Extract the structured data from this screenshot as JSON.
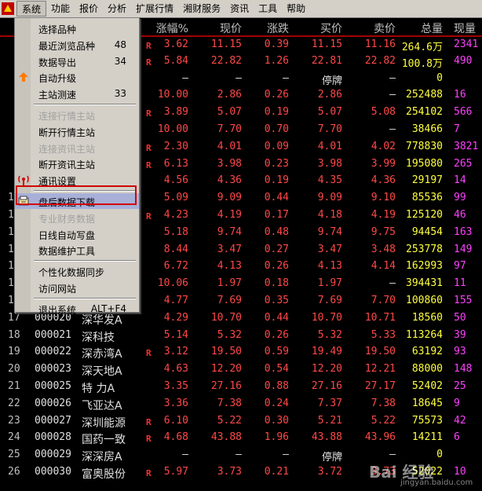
{
  "menubar": {
    "items": [
      "系统",
      "功能",
      "报价",
      "分析",
      "扩展行情",
      "湘财服务",
      "资讯",
      "工具",
      "帮助"
    ]
  },
  "table": {
    "headers": [
      "涨幅%",
      "现价",
      "涨跌",
      "买价",
      "卖价",
      "总量",
      "现量"
    ],
    "rows": [
      {
        "idx": "",
        "code": "",
        "name": "",
        "mark": "R",
        "chg": "3.62",
        "price": "11.15",
        "diff": "0.39",
        "bid": "11.15",
        "ask": "11.16",
        "vol": "264.6万",
        "cur": "2341"
      },
      {
        "idx": "",
        "code": "",
        "name": "",
        "mark": "R",
        "chg": "5.84",
        "price": "22.82",
        "diff": "1.26",
        "bid": "22.81",
        "ask": "22.82",
        "vol": "100.8万",
        "cur": "490"
      },
      {
        "idx": "",
        "code": "",
        "name": "",
        "mark": "",
        "chg": "—",
        "price": "—",
        "diff": "—",
        "bid": "停牌",
        "ask": "—",
        "vol": "0",
        "cur": ""
      },
      {
        "idx": "",
        "code": "",
        "name": "",
        "mark": "",
        "chg": "10.00",
        "price": "2.86",
        "diff": "0.26",
        "bid": "2.86",
        "ask": "—",
        "vol": "252488",
        "cur": "16"
      },
      {
        "idx": "",
        "code": "",
        "name": "",
        "mark": "R",
        "chg": "3.89",
        "price": "5.07",
        "diff": "0.19",
        "bid": "5.07",
        "ask": "5.08",
        "vol": "254102",
        "cur": "566"
      },
      {
        "idx": "",
        "code": "",
        "name": "",
        "mark": "",
        "chg": "10.00",
        "price": "7.70",
        "diff": "0.70",
        "bid": "7.70",
        "ask": "—",
        "vol": "38466",
        "cur": "7"
      },
      {
        "idx": "",
        "code": "",
        "name": "",
        "mark": "R",
        "chg": "2.30",
        "price": "4.01",
        "diff": "0.09",
        "bid": "4.01",
        "ask": "4.02",
        "vol": "778830",
        "cur": "3821"
      },
      {
        "idx": "",
        "code": "",
        "name": "",
        "mark": "R",
        "chg": "6.13",
        "price": "3.98",
        "diff": "0.23",
        "bid": "3.98",
        "ask": "3.99",
        "vol": "195080",
        "cur": "265"
      },
      {
        "idx": "",
        "code": "",
        "name": "",
        "mark": "",
        "chg": "4.56",
        "price": "4.36",
        "diff": "0.19",
        "bid": "4.35",
        "ask": "4.36",
        "vol": "29197",
        "cur": "14"
      },
      {
        "idx": "1",
        "code": "",
        "name": "",
        "mark": "",
        "chg": "5.09",
        "price": "9.09",
        "diff": "0.44",
        "bid": "9.09",
        "ask": "9.10",
        "vol": "85536",
        "cur": "99"
      },
      {
        "idx": "1",
        "code": "",
        "name": "",
        "mark": "R",
        "chg": "4.23",
        "price": "4.19",
        "diff": "0.17",
        "bid": "4.18",
        "ask": "4.19",
        "vol": "125120",
        "cur": "46"
      },
      {
        "idx": "1",
        "code": "",
        "name": "",
        "mark": "",
        "chg": "5.18",
        "price": "9.74",
        "diff": "0.48",
        "bid": "9.74",
        "ask": "9.75",
        "vol": "94454",
        "cur": "163"
      },
      {
        "idx": "1",
        "code": "",
        "name": "",
        "mark": "",
        "chg": "8.44",
        "price": "3.47",
        "diff": "0.27",
        "bid": "3.47",
        "ask": "3.48",
        "vol": "253778",
        "cur": "149"
      },
      {
        "idx": "1",
        "code": "",
        "name": "",
        "mark": "",
        "chg": "6.72",
        "price": "4.13",
        "diff": "0.26",
        "bid": "4.13",
        "ask": "4.14",
        "vol": "162993",
        "cur": "97"
      },
      {
        "idx": "1",
        "code": "",
        "name": "",
        "mark": "",
        "chg": "10.06",
        "price": "1.97",
        "diff": "0.18",
        "bid": "1.97",
        "ask": "—",
        "vol": "394431",
        "cur": "11"
      },
      {
        "idx": "1",
        "code": "",
        "name": "",
        "mark": "",
        "chg": "4.77",
        "price": "7.69",
        "diff": "0.35",
        "bid": "7.69",
        "ask": "7.70",
        "vol": "100860",
        "cur": "155"
      },
      {
        "idx": "17",
        "code": "000020",
        "name": "深华发A",
        "mark": "",
        "chg": "4.29",
        "price": "10.70",
        "diff": "0.44",
        "bid": "10.70",
        "ask": "10.71",
        "vol": "18560",
        "cur": "50"
      },
      {
        "idx": "18",
        "code": "000021",
        "name": "深科技",
        "mark": "",
        "chg": "5.14",
        "price": "5.32",
        "diff": "0.26",
        "bid": "5.32",
        "ask": "5.33",
        "vol": "113264",
        "cur": "39"
      },
      {
        "idx": "19",
        "code": "000022",
        "name": "深赤湾A",
        "mark": "R",
        "chg": "3.12",
        "price": "19.50",
        "diff": "0.59",
        "bid": "19.49",
        "ask": "19.50",
        "vol": "63192",
        "cur": "93"
      },
      {
        "idx": "20",
        "code": "000023",
        "name": "深天地A",
        "mark": "",
        "chg": "4.63",
        "price": "12.20",
        "diff": "0.54",
        "bid": "12.20",
        "ask": "12.21",
        "vol": "88000",
        "cur": "148"
      },
      {
        "idx": "21",
        "code": "000025",
        "name": "特 力A",
        "mark": "",
        "chg": "3.35",
        "price": "27.16",
        "diff": "0.88",
        "bid": "27.16",
        "ask": "27.17",
        "vol": "52402",
        "cur": "25"
      },
      {
        "idx": "22",
        "code": "000026",
        "name": "飞亚达A",
        "mark": "",
        "chg": "3.36",
        "price": "7.38",
        "diff": "0.24",
        "bid": "7.37",
        "ask": "7.38",
        "vol": "18645",
        "cur": "9"
      },
      {
        "idx": "23",
        "code": "000027",
        "name": "深圳能源",
        "mark": "R",
        "chg": "6.10",
        "price": "5.22",
        "diff": "0.30",
        "bid": "5.21",
        "ask": "5.22",
        "vol": "75573",
        "cur": "42"
      },
      {
        "idx": "24",
        "code": "000028",
        "name": "国药一致",
        "mark": "R",
        "chg": "4.68",
        "price": "43.88",
        "diff": "1.96",
        "bid": "43.88",
        "ask": "43.96",
        "vol": "14211",
        "cur": "6"
      },
      {
        "idx": "25",
        "code": "000029",
        "name": "深深房A",
        "mark": "",
        "chg": "—",
        "price": "—",
        "diff": "—",
        "bid": "停牌",
        "ask": "—",
        "vol": "0",
        "cur": ""
      },
      {
        "idx": "26",
        "code": "000030",
        "name": "富奥股份",
        "mark": "R",
        "chg": "5.97",
        "price": "3.73",
        "diff": "0.21",
        "bid": "3.72",
        "ask": "3.73",
        "vol": "52022",
        "cur": "10"
      }
    ]
  },
  "dropdown": {
    "items": [
      {
        "label": "选择品种",
        "shortcut": "",
        "disabled": false,
        "icon": ""
      },
      {
        "label": "最近浏览品种",
        "shortcut": "48",
        "disabled": false,
        "icon": ""
      },
      {
        "label": "数据导出",
        "shortcut": "34",
        "disabled": false,
        "icon": ""
      },
      {
        "label": "自动升级",
        "shortcut": "",
        "disabled": false,
        "icon": "up-arrow-icon"
      },
      {
        "label": "主站测速",
        "shortcut": "33",
        "disabled": false,
        "icon": ""
      },
      {
        "sep": true
      },
      {
        "label": "连接行情主站",
        "shortcut": "",
        "disabled": true,
        "icon": ""
      },
      {
        "label": "断开行情主站",
        "shortcut": "",
        "disabled": false,
        "icon": ""
      },
      {
        "label": "连接资讯主站",
        "shortcut": "",
        "disabled": true,
        "icon": ""
      },
      {
        "label": "断开资讯主站",
        "shortcut": "",
        "disabled": false,
        "icon": ""
      },
      {
        "label": "通讯设置",
        "shortcut": "",
        "disabled": false,
        "icon": "antenna-icon"
      },
      {
        "sep": true
      },
      {
        "label": "盘后数据下载",
        "shortcut": "",
        "disabled": false,
        "icon": "download-icon",
        "highlight": true
      },
      {
        "label": "专业财务数据",
        "shortcut": "",
        "disabled": true,
        "icon": ""
      },
      {
        "label": "日线自动写盘",
        "shortcut": "",
        "disabled": false,
        "icon": ""
      },
      {
        "label": "数据维护工具",
        "shortcut": "",
        "disabled": false,
        "icon": ""
      },
      {
        "sep": true
      },
      {
        "label": "个性化数据同步",
        "shortcut": "",
        "disabled": false,
        "icon": ""
      },
      {
        "label": "访问网站",
        "shortcut": "",
        "disabled": false,
        "icon": ""
      },
      {
        "sep": true
      },
      {
        "label": "退出系统",
        "shortcut": "ALT+F4",
        "disabled": false,
        "icon": ""
      }
    ]
  },
  "watermark": {
    "main": "Bai 经验",
    "sub": "jingyan.baidu.com"
  },
  "colors": {
    "up": "#ff4848",
    "volume": "#ffff40",
    "current": "#ff40ff",
    "menu_bg": "#d4d0c8",
    "highlight_box": "#d00000"
  }
}
